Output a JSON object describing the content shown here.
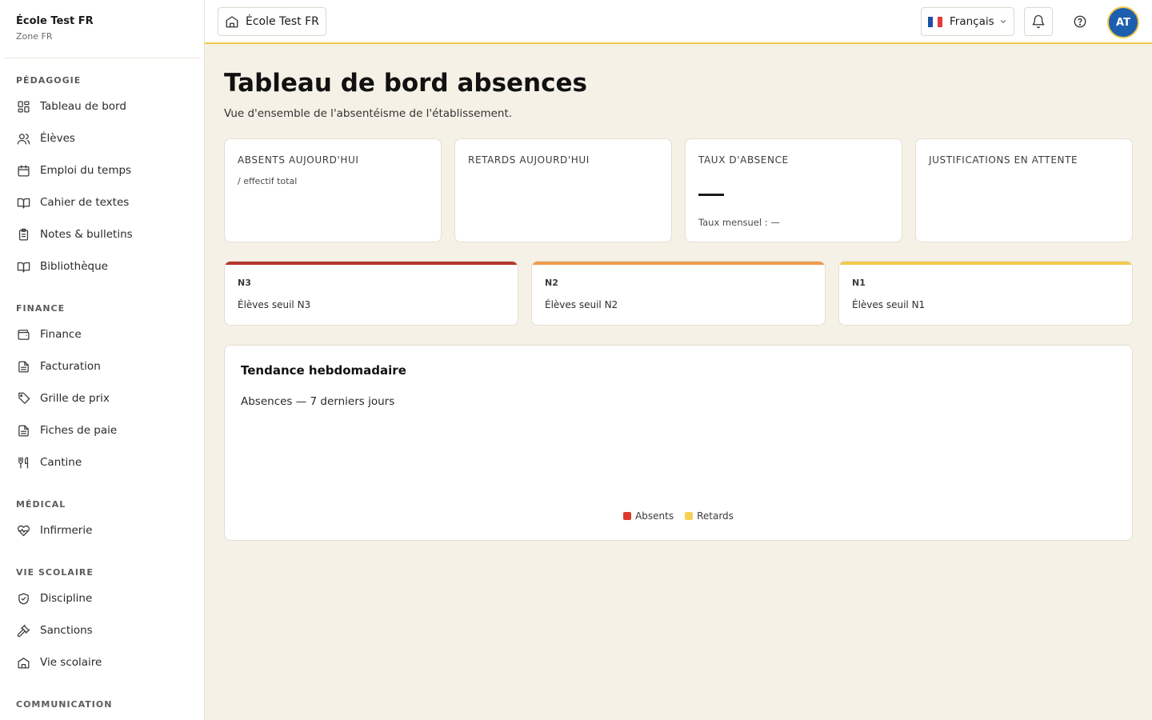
{
  "sidebar": {
    "school_name": "École Test FR",
    "zone": "Zone FR",
    "sections": [
      {
        "label": "PÉDAGOGIE",
        "items": [
          {
            "label": "Tableau de bord",
            "icon": "dashboard-icon"
          },
          {
            "label": "Élèves",
            "icon": "users-icon"
          },
          {
            "label": "Emploi du temps",
            "icon": "calendar-icon"
          },
          {
            "label": "Cahier de textes",
            "icon": "book-open-icon"
          },
          {
            "label": "Notes & bulletins",
            "icon": "clipboard-icon"
          },
          {
            "label": "Bibliothèque",
            "icon": "library-icon"
          }
        ]
      },
      {
        "label": "FINANCE",
        "items": [
          {
            "label": "Finance",
            "icon": "wallet-icon"
          },
          {
            "label": "Facturation",
            "icon": "invoice-icon"
          },
          {
            "label": "Grille de prix",
            "icon": "tag-icon"
          },
          {
            "label": "Fiches de paie",
            "icon": "payslip-icon"
          },
          {
            "label": "Cantine",
            "icon": "utensils-icon"
          }
        ]
      },
      {
        "label": "MÉDICAL",
        "items": [
          {
            "label": "Infirmerie",
            "icon": "heart-pulse-icon"
          }
        ]
      },
      {
        "label": "VIE SCOLAIRE",
        "items": [
          {
            "label": "Discipline",
            "icon": "shield-check-icon"
          },
          {
            "label": "Sanctions",
            "icon": "gavel-icon"
          },
          {
            "label": "Vie scolaire",
            "icon": "school-icon"
          }
        ]
      },
      {
        "label": "COMMUNICATION",
        "items": []
      }
    ]
  },
  "topbar": {
    "school_label": "École Test FR",
    "language": "Français",
    "avatar_initials": "AT",
    "accent_color": "#f2c94c",
    "avatar_color": "#1d5fae"
  },
  "page": {
    "title": "Tableau de bord absences",
    "subtitle": "Vue d'ensemble de l'absentéisme de l'établissement."
  },
  "kpis": {
    "absents": {
      "label": "ABSENTS AUJOURD'HUI",
      "sub": "/ effectif total"
    },
    "retards": {
      "label": "RETARDS AUJOURD'HUI"
    },
    "taux": {
      "label": "TAUX D'ABSENCE",
      "note": "Taux mensuel : —"
    },
    "justifications": {
      "label": "JUSTIFICATIONS EN ATTENTE"
    }
  },
  "thresholds": [
    {
      "code": "N3",
      "desc": "Élèves seuil N3",
      "color": "#b3362e"
    },
    {
      "code": "N2",
      "desc": "Élèves seuil N2",
      "color": "#ee9a4d"
    },
    {
      "code": "N1",
      "desc": "Élèves seuil N1",
      "color": "#f2c94c"
    }
  ],
  "chart": {
    "title": "Tendance hebdomadaire",
    "subtitle": "Absences — 7 derniers jours",
    "legend": [
      {
        "label": "Absents",
        "color": "#d93a2e"
      },
      {
        "label": "Retards",
        "color": "#f7d154"
      }
    ]
  }
}
